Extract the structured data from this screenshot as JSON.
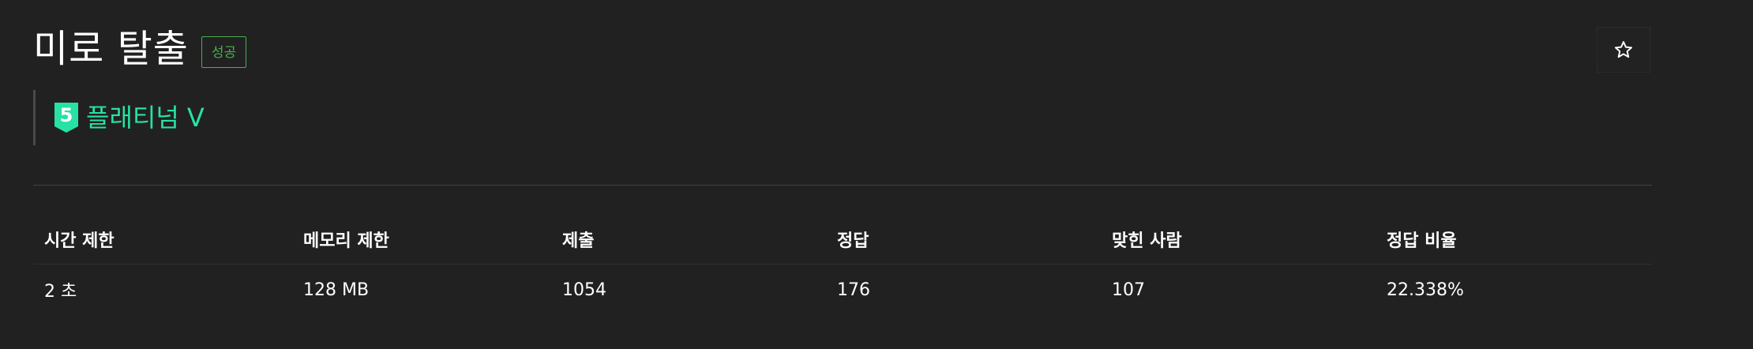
{
  "problem": {
    "title": "미로 탈출",
    "status": "성공",
    "tier": {
      "number": "5",
      "label": "플래티넘 V",
      "color": "#27e2a4"
    },
    "favorite_icon": "star-icon"
  },
  "stats": {
    "headers": [
      "시간 제한",
      "메모리 제한",
      "제출",
      "정답",
      "맞힌 사람",
      "정답 비율"
    ],
    "values": [
      "2 초",
      "128 MB",
      "1054",
      "176",
      "107",
      "22.338%"
    ]
  }
}
